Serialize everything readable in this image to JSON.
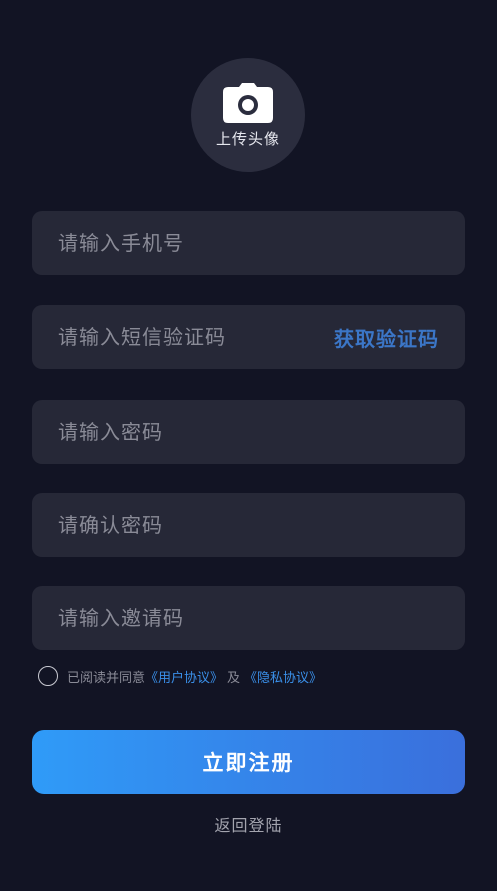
{
  "avatar": {
    "icon": "camera-icon",
    "label": "上传头像"
  },
  "fields": {
    "phone_placeholder": "请输入手机号",
    "sms_placeholder": "请输入短信验证码",
    "get_code_label": "获取验证码",
    "password_placeholder": "请输入密码",
    "confirm_placeholder": "请确认密码",
    "invite_placeholder": "请输入邀请码"
  },
  "agreement": {
    "prefix": "已阅读并同意",
    "user_agreement": "《用户协议》",
    "and": "及",
    "privacy_agreement": "《隐私协议》"
  },
  "actions": {
    "register_label": "立即注册",
    "back_label": "返回登陆"
  },
  "colors": {
    "background": "#121424",
    "field": "#262837",
    "accent_link": "#3a8fe8",
    "button_gradient_start": "#2f9bf8",
    "button_gradient_end": "#3a6fdc"
  }
}
